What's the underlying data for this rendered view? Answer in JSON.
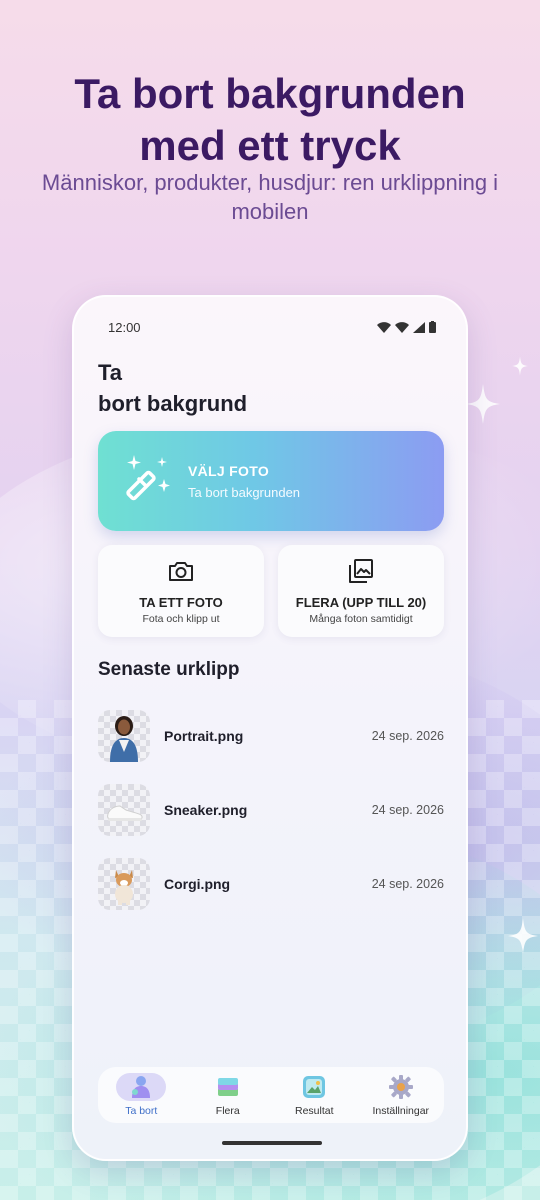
{
  "promo": {
    "headline_line1": "Ta bort bakgrunden",
    "headline_line2": "med ett tryck",
    "subline": "Människor, produkter, husdjur: ren urklippning i mobilen"
  },
  "status_bar": {
    "time": "12:00",
    "icons": [
      "wifi-icon",
      "wifi-icon",
      "signal-icon",
      "battery-icon"
    ]
  },
  "app": {
    "title_line1": "Ta",
    "title_line2": "bort bakgrund"
  },
  "primary_action": {
    "icon": "magic-wand-icon",
    "title": "VÄLJ FOTO",
    "subtitle": "Ta bort bakgrunden"
  },
  "secondary_actions": [
    {
      "icon": "camera-icon",
      "title": "TA ETT FOTO",
      "subtitle": "Fota och klipp ut"
    },
    {
      "icon": "photo-library-icon",
      "title": "FLERA (UPP TILL 20)",
      "subtitle": "Många foton samtidigt"
    }
  ],
  "recent": {
    "title": "Senaste urklipp",
    "items": [
      {
        "name": "Portrait.png",
        "date": "24 sep. 2026",
        "thumb": "woman-portrait"
      },
      {
        "name": "Sneaker.png",
        "date": "24 sep. 2026",
        "thumb": "sneaker"
      },
      {
        "name": "Corgi.png",
        "date": "24 sep. 2026",
        "thumb": "corgi"
      }
    ]
  },
  "bottom_nav": {
    "items": [
      {
        "label": "Ta bort",
        "icon": "person-cutout-icon",
        "active": true
      },
      {
        "label": "Flera",
        "icon": "stacked-layers-icon",
        "active": false
      },
      {
        "label": "Resultat",
        "icon": "gallery-icon",
        "active": false
      },
      {
        "label": "Inställningar",
        "icon": "gear-icon",
        "active": false
      }
    ]
  },
  "colors": {
    "headline": "#3b1a63",
    "primary_gradient_start": "#6fe0d2",
    "primary_gradient_end": "#8c9cf2",
    "nav_active": "#3f6fc8"
  }
}
